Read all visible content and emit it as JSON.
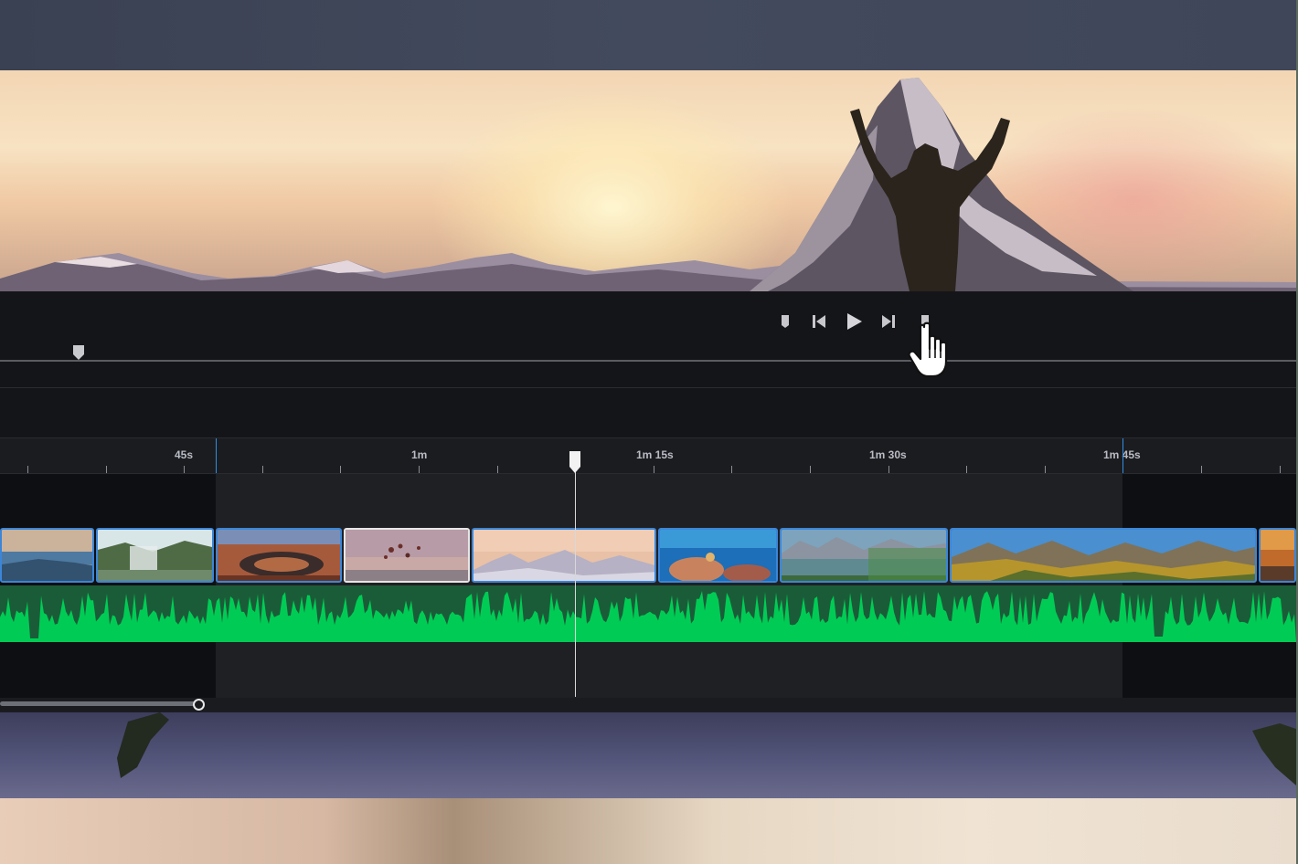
{
  "app": {
    "accent_color": "#3b86d8",
    "audio_color": "#00cc55"
  },
  "transport": {
    "buttons": [
      {
        "name": "mark-in",
        "icon": "mark-in-icon"
      },
      {
        "name": "skip-back",
        "icon": "skip-back-icon"
      },
      {
        "name": "play",
        "icon": "play-icon"
      },
      {
        "name": "skip-forward",
        "icon": "skip-forward-icon"
      },
      {
        "name": "mark-out",
        "icon": "mark-out-icon"
      }
    ]
  },
  "ruler": {
    "labels": [
      "45s",
      "1m",
      "1m 15s",
      "1m 30s",
      "1m 45s"
    ]
  },
  "clips": [
    {
      "name": "coast",
      "selected": false
    },
    {
      "name": "waterfall",
      "selected": false
    },
    {
      "name": "canyon",
      "selected": false
    },
    {
      "name": "balloons",
      "selected": true
    },
    {
      "name": "summit",
      "selected": false
    },
    {
      "name": "coral",
      "selected": false
    },
    {
      "name": "lake",
      "selected": false
    },
    {
      "name": "autumn-valley",
      "selected": false
    },
    {
      "name": "sunset",
      "selected": false
    }
  ],
  "cursor": {
    "icon": "hand-pointer-icon"
  }
}
